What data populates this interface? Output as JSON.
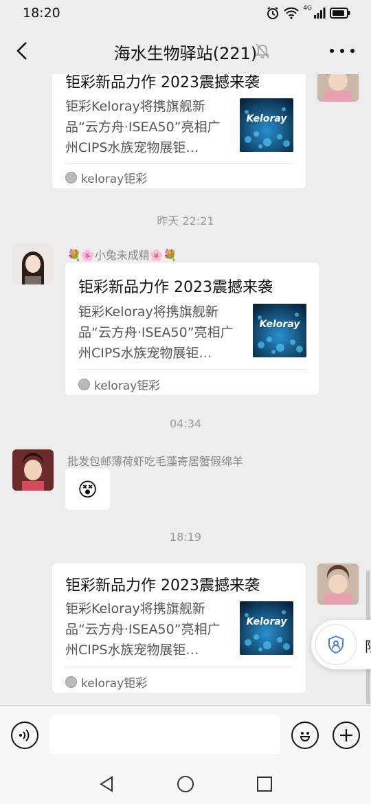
{
  "status_bar": {
    "time": "18:20",
    "network": "4G"
  },
  "header": {
    "title": "海水生物驿站(221)"
  },
  "messages": [
    {
      "card": {
        "title": "钜彩新品力作 2023震撼来袭",
        "desc": "钜彩Keloray将携旗舰新品“云方舟·ISEA50”亮相广州CIPS水族宠物展钜…",
        "thumb_text": "Keloray",
        "source": "keloray钜彩"
      }
    },
    {
      "timestamp": "昨天 22:21"
    },
    {
      "sender": "💐🌸小兔未成精🌸💐",
      "card": {
        "title": "钜彩新品力作 2023震撼来袭",
        "desc": "钜彩Keloray将携旗舰新品“云方舟·ISEA50”亮相广州CIPS水族宠物展钜…",
        "thumb_text": "Keloray",
        "source": "keloray钜彩"
      }
    },
    {
      "timestamp": "04:34"
    },
    {
      "sender": "批发包邮薄荷虾吃毛藻寄居蟹假绵羊",
      "emoji": "😵"
    },
    {
      "timestamp": "18:19"
    },
    {
      "card": {
        "title": "钜彩新品力作 2023震撼来袭",
        "desc": "钜彩Keloray将携旗舰新品“云方舟·ISEA50”亮相广州CIPS水族宠物展钜…",
        "thumb_text": "Keloray",
        "source": "keloray钜彩"
      }
    }
  ],
  "floating": {
    "label": "限"
  },
  "input": {
    "placeholder": ""
  },
  "colors": {
    "background": "#ededed",
    "card": "#ffffff",
    "thumb": "#0f4e7a"
  }
}
